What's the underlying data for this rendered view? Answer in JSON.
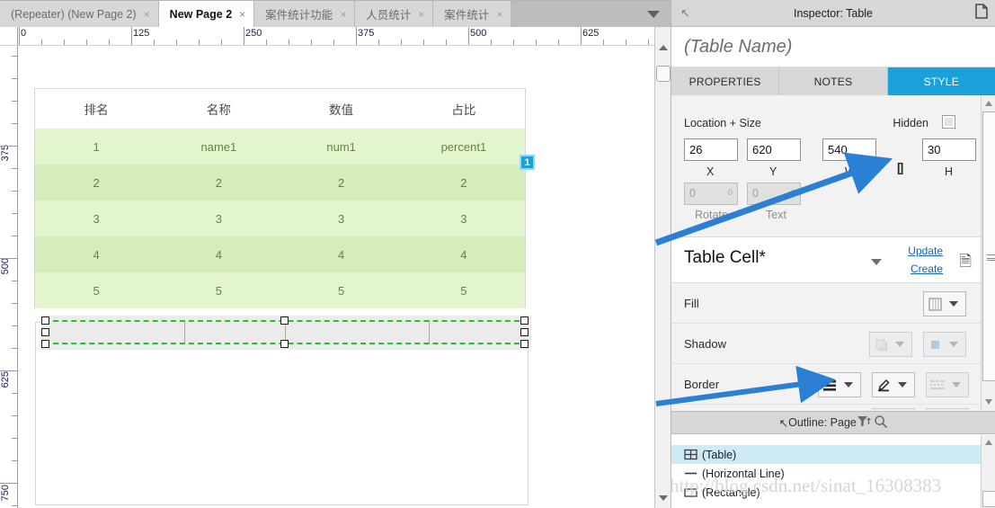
{
  "tabs": [
    {
      "label": "(Repeater) (New Page 2)",
      "active": false,
      "close": "×"
    },
    {
      "label": "New Page 2",
      "active": true,
      "close": "×"
    },
    {
      "label": "案件统计功能",
      "active": false,
      "close": "×"
    },
    {
      "label": "人员统计",
      "active": false,
      "close": "×"
    },
    {
      "label": "案件统计",
      "active": false,
      "close": "×"
    }
  ],
  "rulers": {
    "horizontal_labels": [
      "0",
      "125",
      "250",
      "375",
      "500",
      "625"
    ],
    "vertical_labels": [
      "375",
      "500",
      "625",
      "750"
    ],
    "unit_scale": "1:1"
  },
  "canvas": {
    "repeater_table": {
      "headers": [
        "排名",
        "名称",
        "数值",
        "占比"
      ],
      "rows": [
        [
          "1",
          "name1",
          "num1",
          "percent1"
        ],
        [
          "2",
          "2",
          "2",
          "2"
        ],
        [
          "3",
          "3",
          "3",
          "3"
        ],
        [
          "4",
          "4",
          "4",
          "4"
        ],
        [
          "5",
          "5",
          "5",
          "5"
        ]
      ]
    },
    "badge": "1",
    "selection_handles": 8
  },
  "inspector": {
    "title": "Inspector: Table",
    "widget_name_placeholder": "(Table Name)",
    "tabs": [
      {
        "label": "PROPERTIES",
        "active": false
      },
      {
        "label": "NOTES",
        "active": false
      },
      {
        "label": "STYLE",
        "active": true
      }
    ],
    "location_size": {
      "section_label": "Location + Size",
      "hidden_label": "Hidden",
      "x": "26",
      "x_label": "X",
      "y": "620",
      "y_label": "Y",
      "w": "540",
      "w_label": "W",
      "h": "30",
      "h_label": "H",
      "rotate": "0",
      "rotate_label": "Rotate",
      "text_rotate": "0",
      "text_label": "Text",
      "degree": "0"
    },
    "style": {
      "style_name": "Table Cell*",
      "update_label": "Update",
      "create_label": "Create"
    },
    "properties": [
      {
        "label": "Fill"
      },
      {
        "label": "Shadow"
      },
      {
        "label": "Border"
      }
    ]
  },
  "outline": {
    "title": "Outline: Page",
    "items": [
      {
        "label": "(Table)",
        "icon": "table-icon",
        "selected": true
      },
      {
        "label": "(Horizontal Line)",
        "icon": "hline-icon",
        "selected": false
      },
      {
        "label": "(Rectangle)",
        "icon": "rectangle-icon",
        "selected": false
      }
    ]
  },
  "watermark": "http://blog.csdn.net/sinat_16308383",
  "colors": {
    "accent": "#1ba1d9",
    "selection_green": "#27c227",
    "row_light": "#e3f5cd",
    "row_dark": "#d5ecbb",
    "arrow_blue": "#2b7fd4",
    "link": "#1464b4"
  }
}
